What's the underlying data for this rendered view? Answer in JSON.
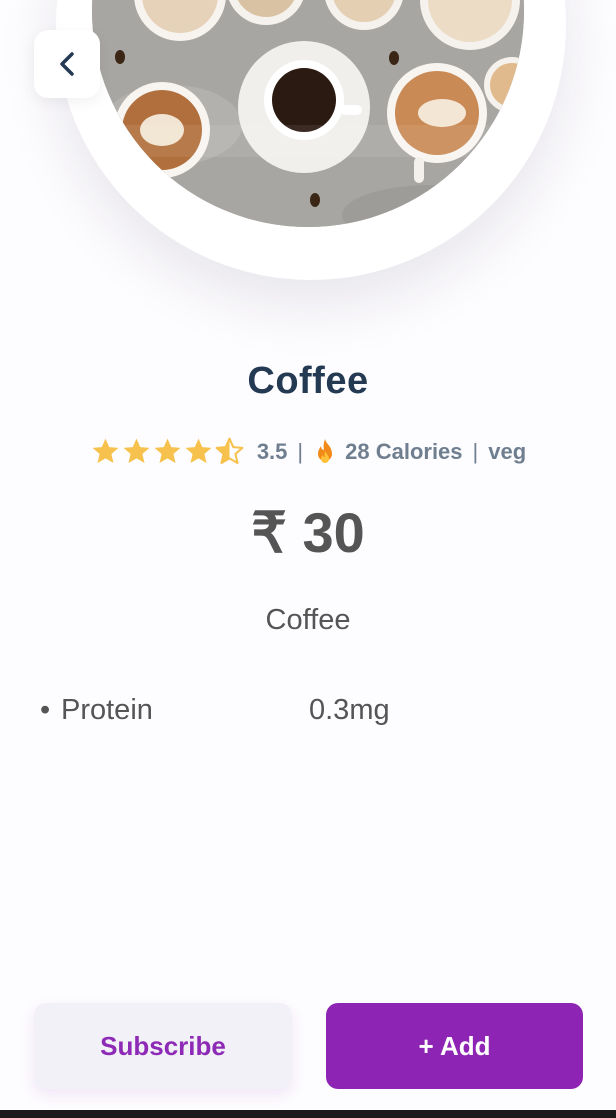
{
  "product": {
    "name": "Coffee",
    "rating": "3.5",
    "rating_value": 3.5,
    "rating_max": 5,
    "calories": "28 Calories",
    "diet": "veg",
    "price": "₹ 30",
    "description": "Coffee"
  },
  "separators": {
    "pipe": "|"
  },
  "nutrients": [
    {
      "bullet": "•",
      "name": "Protein",
      "value": "0.3mg"
    }
  ],
  "actions": {
    "subscribe_label": "Subscribe",
    "add_label": "+ Add"
  },
  "icons": {
    "back": "chevron-left-icon",
    "star": "star-icon",
    "flame": "fire-icon"
  },
  "colors": {
    "title": "#243a53",
    "accent_purple": "#8e24b4",
    "star_gold": "#f6c24d",
    "flame_orange": "#f28a1a",
    "meta_gray": "#6f7f90",
    "text_gray": "#555555"
  }
}
